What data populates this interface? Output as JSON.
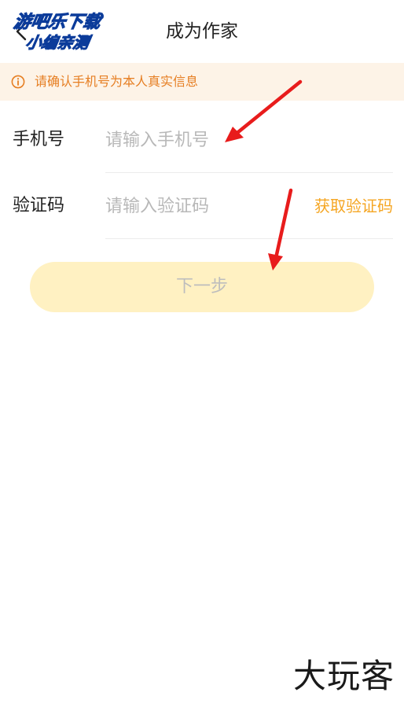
{
  "header": {
    "title": "成为作家",
    "back_icon": "chevron-left-icon"
  },
  "watermark_top": {
    "line1": "游吧乐下载",
    "line2": "小编亲测"
  },
  "notice": {
    "icon": "info-circle-icon",
    "text": "请确认手机号为本人真实信息",
    "color": "#e67e22"
  },
  "form": {
    "phone": {
      "label": "手机号",
      "placeholder": "请输入手机号",
      "value": ""
    },
    "code": {
      "label": "验证码",
      "placeholder": "请输入验证码",
      "value": "",
      "get_code_label": "获取验证码"
    }
  },
  "next_button": {
    "label": "下一步"
  },
  "watermark_bottom": {
    "text": "大玩客"
  },
  "colors": {
    "accent": "#f5a623",
    "notice_bg": "#fdf3e7",
    "button_bg": "#fff1c2",
    "arrow": "#e81c1c"
  }
}
